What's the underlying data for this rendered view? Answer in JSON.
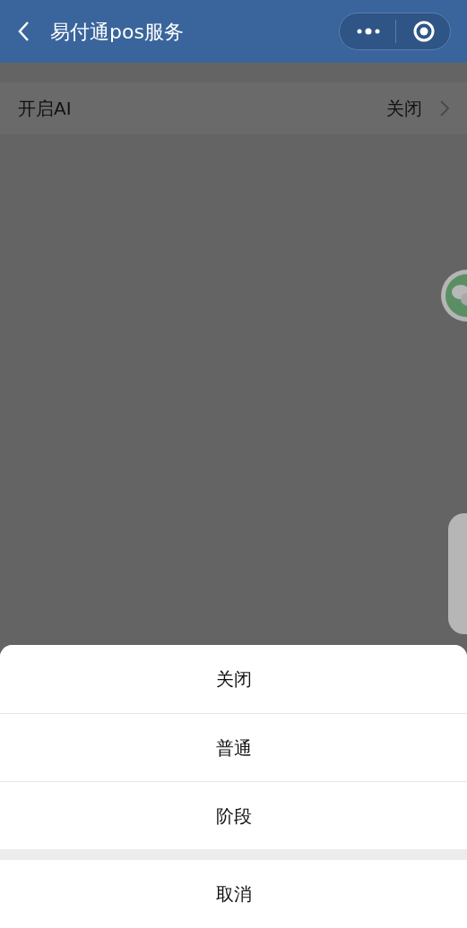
{
  "nav_bar": {
    "title": "易付通pos服务"
  },
  "settings": [
    {
      "label": "开启AI",
      "value": "关闭"
    }
  ],
  "action_sheet": {
    "options": [
      {
        "label": "关闭"
      },
      {
        "label": "普通"
      },
      {
        "label": "阶段"
      }
    ],
    "cancel": "取消"
  }
}
